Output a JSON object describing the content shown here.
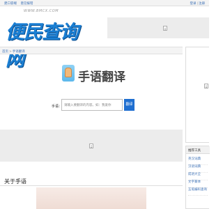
{
  "topbar": {
    "links": [
      "建口容端",
      "意见报错"
    ],
    "login": "登录",
    "separator": "|",
    "register": "注册"
  },
  "logo": {
    "domain": "WWW.BMCX.COM",
    "name": "便民查询网"
  },
  "breadcrumb": {
    "home": "首页",
    "arrow": ">",
    "current": "手语翻译"
  },
  "page": {
    "title": "手语翻译"
  },
  "search": {
    "label": "手语：",
    "placeholder": "请输入要翻译的内容。如：我爱你",
    "button": "翻译"
  },
  "section": {
    "title": "关于手语"
  },
  "sidebar": {
    "tools_title": "推荐工具",
    "tools": [
      "英汉词典",
      "汉语词典",
      "成语大全",
      "文字篆体",
      "五笔编码查询"
    ]
  },
  "icons": [
    "hand-sign-icon",
    "ad-placeholder-icon"
  ],
  "colors": {
    "brand_blue": "#1b7fd3",
    "button_blue": "#1f6fd0",
    "link_blue": "#3a6fb5"
  }
}
